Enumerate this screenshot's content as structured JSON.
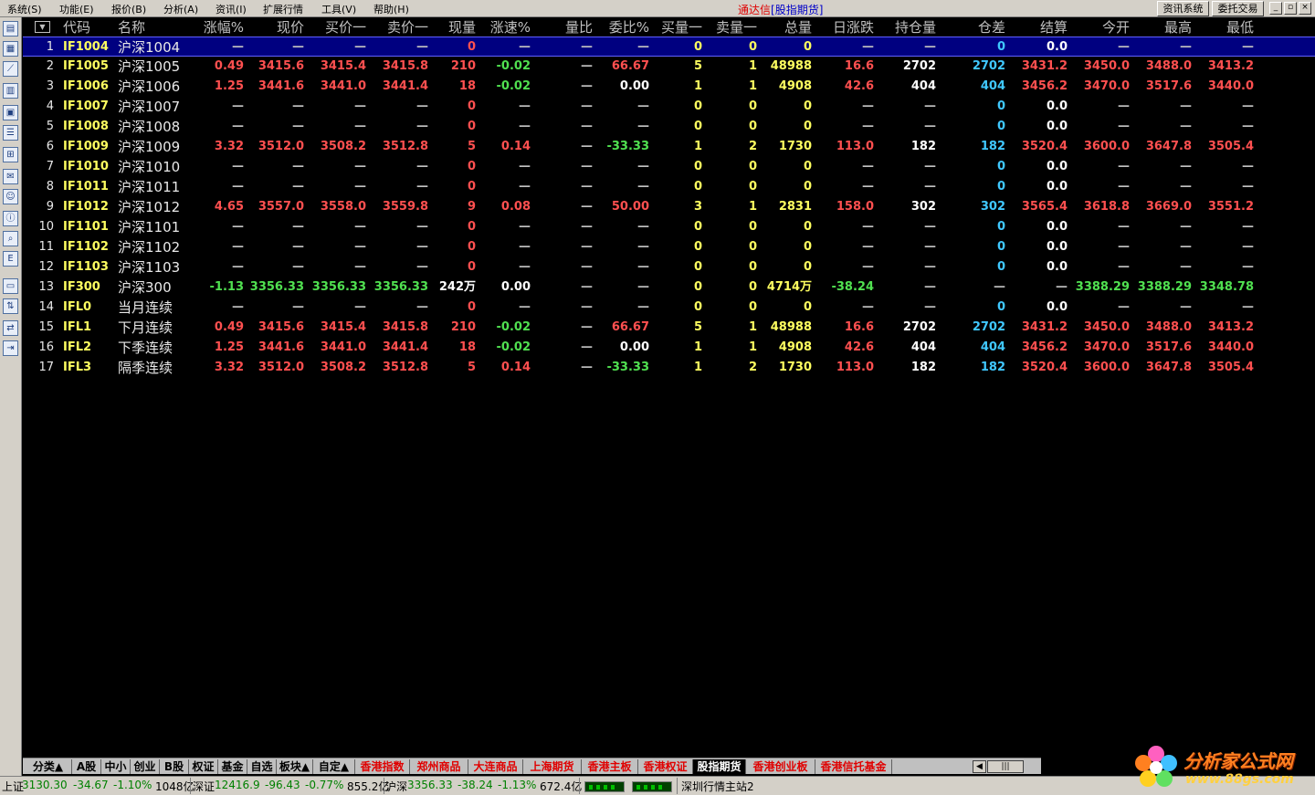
{
  "menu": [
    "系统(S)",
    "功能(E)",
    "报价(B)",
    "分析(A)",
    "资讯(I)",
    "扩展行情",
    "工具(V)",
    "帮助(H)"
  ],
  "title": {
    "brand": "通达信",
    "mode": "[股指期货]"
  },
  "top_buttons": [
    "资讯系统",
    "委托交易"
  ],
  "window_buttons": [
    "minimize-icon",
    "restore-icon",
    "close-icon"
  ],
  "left_toolbar_icons": [
    "quote-list-icon",
    "grid-icon",
    "line-chart-icon",
    "candle-chart-icon",
    "table-icon",
    "report-icon",
    "f10-icon",
    "message-icon",
    "users-icon",
    "info-icon",
    "search-icon",
    "etf-icon",
    "folder-icon",
    "trade-icon",
    "transfer-icon",
    "exit-icon"
  ],
  "columns": [
    "代码",
    "名称",
    "涨幅%",
    "现价",
    "买价一",
    "卖价一",
    "现量",
    "涨速%",
    "量比",
    "委比%",
    "买量一",
    "卖量一",
    "总量",
    "日涨跌",
    "持仓量",
    "仓差",
    "结算",
    "今开",
    "最高",
    "最低"
  ],
  "rows": [
    {
      "idx": "1",
      "code": "IF1004",
      "name": "沪深1004",
      "chg": "—",
      "price": "—",
      "bid1": "—",
      "ask1": "—",
      "vol": "0",
      "speed": "—",
      "ratio": "—",
      "wb": "—",
      "bidq": "0",
      "askq": "0",
      "total": "0",
      "daychg": "—",
      "oi": "—",
      "oichg": "0",
      "settle": "0.0",
      "open": "—",
      "high": "—",
      "low": "—"
    },
    {
      "idx": "2",
      "code": "IF1005",
      "name": "沪深1005",
      "chg": "0.49",
      "price": "3415.6",
      "bid1": "3415.4",
      "ask1": "3415.8",
      "vol": "210",
      "speed": "-0.02",
      "ratio": "—",
      "wb": "66.67",
      "bidq": "5",
      "askq": "1",
      "total": "48988",
      "daychg": "16.6",
      "oi": "2702",
      "oichg": "2702",
      "settle": "3431.2",
      "open": "3450.0",
      "high": "3488.0",
      "low": "3413.2"
    },
    {
      "idx": "3",
      "code": "IF1006",
      "name": "沪深1006",
      "chg": "1.25",
      "price": "3441.6",
      "bid1": "3441.0",
      "ask1": "3441.4",
      "vol": "18",
      "speed": "-0.02",
      "ratio": "—",
      "wb": "0.00",
      "bidq": "1",
      "askq": "1",
      "total": "4908",
      "daychg": "42.6",
      "oi": "404",
      "oichg": "404",
      "settle": "3456.2",
      "open": "3470.0",
      "high": "3517.6",
      "low": "3440.0"
    },
    {
      "idx": "4",
      "code": "IF1007",
      "name": "沪深1007",
      "chg": "—",
      "price": "—",
      "bid1": "—",
      "ask1": "—",
      "vol": "0",
      "speed": "—",
      "ratio": "—",
      "wb": "—",
      "bidq": "0",
      "askq": "0",
      "total": "0",
      "daychg": "—",
      "oi": "—",
      "oichg": "0",
      "settle": "0.0",
      "open": "—",
      "high": "—",
      "low": "—"
    },
    {
      "idx": "5",
      "code": "IF1008",
      "name": "沪深1008",
      "chg": "—",
      "price": "—",
      "bid1": "—",
      "ask1": "—",
      "vol": "0",
      "speed": "—",
      "ratio": "—",
      "wb": "—",
      "bidq": "0",
      "askq": "0",
      "total": "0",
      "daychg": "—",
      "oi": "—",
      "oichg": "0",
      "settle": "0.0",
      "open": "—",
      "high": "—",
      "low": "—"
    },
    {
      "idx": "6",
      "code": "IF1009",
      "name": "沪深1009",
      "chg": "3.32",
      "price": "3512.0",
      "bid1": "3508.2",
      "ask1": "3512.8",
      "vol": "5",
      "speed": "0.14",
      "ratio": "—",
      "wb": "-33.33",
      "bidq": "1",
      "askq": "2",
      "total": "1730",
      "daychg": "113.0",
      "oi": "182",
      "oichg": "182",
      "settle": "3520.4",
      "open": "3600.0",
      "high": "3647.8",
      "low": "3505.4"
    },
    {
      "idx": "7",
      "code": "IF1010",
      "name": "沪深1010",
      "chg": "—",
      "price": "—",
      "bid1": "—",
      "ask1": "—",
      "vol": "0",
      "speed": "—",
      "ratio": "—",
      "wb": "—",
      "bidq": "0",
      "askq": "0",
      "total": "0",
      "daychg": "—",
      "oi": "—",
      "oichg": "0",
      "settle": "0.0",
      "open": "—",
      "high": "—",
      "low": "—"
    },
    {
      "idx": "8",
      "code": "IF1011",
      "name": "沪深1011",
      "chg": "—",
      "price": "—",
      "bid1": "—",
      "ask1": "—",
      "vol": "0",
      "speed": "—",
      "ratio": "—",
      "wb": "—",
      "bidq": "0",
      "askq": "0",
      "total": "0",
      "daychg": "—",
      "oi": "—",
      "oichg": "0",
      "settle": "0.0",
      "open": "—",
      "high": "—",
      "low": "—"
    },
    {
      "idx": "9",
      "code": "IF1012",
      "name": "沪深1012",
      "chg": "4.65",
      "price": "3557.0",
      "bid1": "3558.0",
      "ask1": "3559.8",
      "vol": "9",
      "speed": "0.08",
      "ratio": "—",
      "wb": "50.00",
      "bidq": "3",
      "askq": "1",
      "total": "2831",
      "daychg": "158.0",
      "oi": "302",
      "oichg": "302",
      "settle": "3565.4",
      "open": "3618.8",
      "high": "3669.0",
      "low": "3551.2"
    },
    {
      "idx": "10",
      "code": "IF1101",
      "name": "沪深1101",
      "chg": "—",
      "price": "—",
      "bid1": "—",
      "ask1": "—",
      "vol": "0",
      "speed": "—",
      "ratio": "—",
      "wb": "—",
      "bidq": "0",
      "askq": "0",
      "total": "0",
      "daychg": "—",
      "oi": "—",
      "oichg": "0",
      "settle": "0.0",
      "open": "—",
      "high": "—",
      "low": "—"
    },
    {
      "idx": "11",
      "code": "IF1102",
      "name": "沪深1102",
      "chg": "—",
      "price": "—",
      "bid1": "—",
      "ask1": "—",
      "vol": "0",
      "speed": "—",
      "ratio": "—",
      "wb": "—",
      "bidq": "0",
      "askq": "0",
      "total": "0",
      "daychg": "—",
      "oi": "—",
      "oichg": "0",
      "settle": "0.0",
      "open": "—",
      "high": "—",
      "low": "—"
    },
    {
      "idx": "12",
      "code": "IF1103",
      "name": "沪深1103",
      "chg": "—",
      "price": "—",
      "bid1": "—",
      "ask1": "—",
      "vol": "0",
      "speed": "—",
      "ratio": "—",
      "wb": "—",
      "bidq": "0",
      "askq": "0",
      "total": "0",
      "daychg": "—",
      "oi": "—",
      "oichg": "0",
      "settle": "0.0",
      "open": "—",
      "high": "—",
      "low": "—"
    },
    {
      "idx": "13",
      "code": "IF300",
      "name": "沪深300",
      "chg": "-1.13",
      "price": "3356.33",
      "bid1": "3356.33",
      "ask1": "3356.33",
      "vol": "242万",
      "speed": "0.00",
      "ratio": "—",
      "wb": "—",
      "bidq": "0",
      "askq": "0",
      "total": "4714万",
      "daychg": "-38.24",
      "oi": "—",
      "oichg": "—",
      "settle": "—",
      "open": "3388.29",
      "high": "3388.29",
      "low": "3348.78"
    },
    {
      "idx": "14",
      "code": "IFL0",
      "name": "当月连续",
      "chg": "—",
      "price": "—",
      "bid1": "—",
      "ask1": "—",
      "vol": "0",
      "speed": "—",
      "ratio": "—",
      "wb": "—",
      "bidq": "0",
      "askq": "0",
      "total": "0",
      "daychg": "—",
      "oi": "—",
      "oichg": "0",
      "settle": "0.0",
      "open": "—",
      "high": "—",
      "low": "—"
    },
    {
      "idx": "15",
      "code": "IFL1",
      "name": "下月连续",
      "chg": "0.49",
      "price": "3415.6",
      "bid1": "3415.4",
      "ask1": "3415.8",
      "vol": "210",
      "speed": "-0.02",
      "ratio": "—",
      "wb": "66.67",
      "bidq": "5",
      "askq": "1",
      "total": "48988",
      "daychg": "16.6",
      "oi": "2702",
      "oichg": "2702",
      "settle": "3431.2",
      "open": "3450.0",
      "high": "3488.0",
      "low": "3413.2"
    },
    {
      "idx": "16",
      "code": "IFL2",
      "name": "下季连续",
      "chg": "1.25",
      "price": "3441.6",
      "bid1": "3441.0",
      "ask1": "3441.4",
      "vol": "18",
      "speed": "-0.02",
      "ratio": "—",
      "wb": "0.00",
      "bidq": "1",
      "askq": "1",
      "total": "4908",
      "daychg": "42.6",
      "oi": "404",
      "oichg": "404",
      "settle": "3456.2",
      "open": "3470.0",
      "high": "3517.6",
      "low": "3440.0"
    },
    {
      "idx": "17",
      "code": "IFL3",
      "name": "隔季连续",
      "chg": "3.32",
      "price": "3512.0",
      "bid1": "3508.2",
      "ask1": "3512.8",
      "vol": "5",
      "speed": "0.14",
      "ratio": "—",
      "wb": "-33.33",
      "bidq": "1",
      "askq": "2",
      "total": "1730",
      "daychg": "113.0",
      "oi": "182",
      "oichg": "182",
      "settle": "3520.4",
      "open": "3600.0",
      "high": "3647.8",
      "low": "3505.4"
    }
  ],
  "tabs": [
    {
      "label": "分类▲",
      "color": "black"
    },
    {
      "label": "A股",
      "color": "black"
    },
    {
      "label": "中小",
      "color": "black"
    },
    {
      "label": "创业",
      "color": "black"
    },
    {
      "label": "B股",
      "color": "black"
    },
    {
      "label": "权证",
      "color": "black"
    },
    {
      "label": "基金",
      "color": "black"
    },
    {
      "label": "自选",
      "color": "black"
    },
    {
      "label": "板块▲",
      "color": "black"
    },
    {
      "label": "自定▲",
      "color": "black"
    },
    {
      "label": "香港指数",
      "color": "red"
    },
    {
      "label": "郑州商品",
      "color": "red"
    },
    {
      "label": "大连商品",
      "color": "red"
    },
    {
      "label": "上海期货",
      "color": "red"
    },
    {
      "label": "香港主板",
      "color": "red"
    },
    {
      "label": "香港权证",
      "color": "red"
    },
    {
      "label": "股指期货",
      "color": "active"
    },
    {
      "label": "香港创业板",
      "color": "red"
    },
    {
      "label": "香港信托基金",
      "color": "red"
    }
  ],
  "status": {
    "sh_label": "上证",
    "sh_value": "3130.30",
    "sh_chg": "-34.67",
    "sh_pct": "-1.10%",
    "sh_amt": "1048亿",
    "sz_label": "深证",
    "sz_value": "12416.9",
    "sz_chg": "-96.43",
    "sz_pct": "-0.77%",
    "sz_amt": "855.2亿",
    "hs_label": "沪深",
    "hs_value": "3356.33",
    "hs_chg": "-38.24",
    "hs_pct": "-1.13%",
    "hs_amt": "672.4亿",
    "server": "深圳行情主站2"
  },
  "logo": {
    "line1": "分析家公式网",
    "line2": "www.88gs.com"
  },
  "colors": {
    "up": "#ff5050",
    "down": "#50e050",
    "code": "#ffff60",
    "oi_change": "#40c8ff",
    "selected_row": "#000080"
  }
}
